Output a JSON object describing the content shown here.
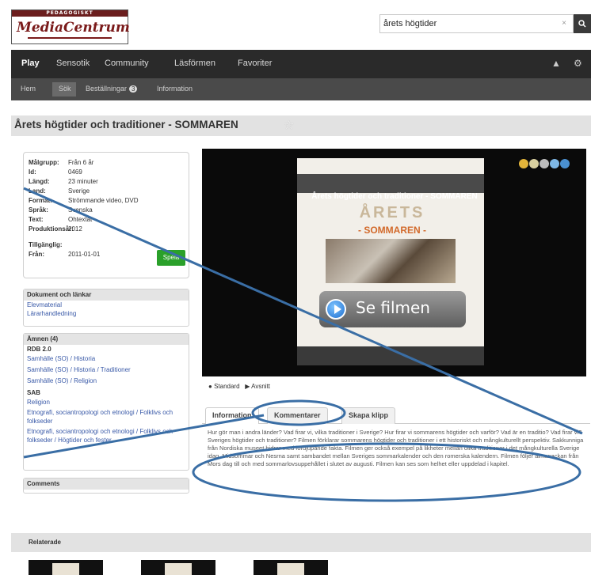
{
  "brand": {
    "top_text": "PEDAGOGISKT",
    "logo": "MediaCentrum"
  },
  "search": {
    "value": "årets högtider",
    "clear_icon": "×",
    "button_icon": "search-icon"
  },
  "nav": {
    "main": [
      "Play",
      "Sensotik",
      "Community",
      "Läsförmen",
      "Favoriter"
    ],
    "sub": [
      "Hem",
      "Sök",
      "Beställningar",
      "Information"
    ],
    "sub_badge": "3"
  },
  "page": {
    "title": "Årets högtider och traditioner - SOMMAREN"
  },
  "info": {
    "rows": [
      {
        "k": "Målgrupp:",
        "v": "Från 6 år"
      },
      {
        "k": "Id:",
        "v": "0469"
      },
      {
        "k": "Längd:",
        "v": "23 minuter"
      },
      {
        "k": "Land:",
        "v": "Sverige"
      },
      {
        "k": "Format:",
        "v": "Strömmande video, DVD"
      },
      {
        "k": "Språk:",
        "v": "Svenska"
      },
      {
        "k": "Text:",
        "v": "Ohtextat"
      },
      {
        "k": "Produktionsår:",
        "v": "2012"
      },
      {
        "k": "Tillgänglig:",
        "v": ""
      },
      {
        "k": "Från:",
        "v": "2011-01-01"
      }
    ],
    "play_button": "Spela"
  },
  "docs": {
    "head": "Dokument och länkar",
    "links": [
      "Elevmaterial",
      "Lärarhandledning"
    ]
  },
  "subjects": {
    "head": "Ämnen (4)",
    "groups": [
      {
        "name": "RDB 2.0",
        "links": [
          "Samhälle (SO) / Historia",
          "Samhälle (SO) / Historia / Traditioner",
          "Samhälle (SO) / Religion"
        ]
      },
      {
        "name": "SAB",
        "links": [
          "Religion",
          "Etnografi, sociantropologi och etnologi / Folklivs och folkseder",
          "Etnografi, sociantropologi och etnologi / Folklivs och folkseder / Högtider och fester"
        ]
      }
    ]
  },
  "comments_panel": {
    "head": "Comments"
  },
  "video": {
    "title": "Årets högtider och traditioner - SOMMAREN",
    "poster_big": "ÅRETS",
    "poster_sub": "- SOMMAREN -",
    "play_label": "Se filmen",
    "controls": [
      "Standard",
      "Avsnitt"
    ]
  },
  "tabs": [
    "Information",
    "Kommentarer",
    "Skapa klipp"
  ],
  "description": "Hur gör man i andra länder? Vad firar vi, vilka traditioner i Sverige? Hur firar vi sommarens högtider och varför? Vad är en traditio? Vad firar vi? Sveriges högtider och traditioner? Filmen förklarar sommarens högtider och traditioner i ett historiskt och mångkulturellt perspektiv. Sakkunniga från Nordiska museet bidrar med fördjupande fakta. Filmen ger också exempel på likheter mellan olika traditioner i det mångkulturella Sverige idag. Midsommar och Nesrna samt sambandet mellan Sveriges sommarkalender och den romerska kalendern. Filmen följer almanackan från Mors dag till och med sommarlovsuppehållet i slutet av augusti. Filmen kan ses som helhet eller uppdelad i kapitel.",
  "related": {
    "label": "Relaterade"
  },
  "colors": {
    "nav": "#2a2a2a",
    "subnav": "#4a4a4a",
    "play_button": "#2aa02a",
    "annotation": "#3a6ea5",
    "link": "#3a5aa8"
  }
}
